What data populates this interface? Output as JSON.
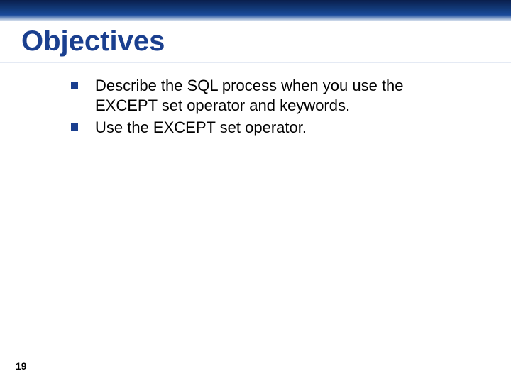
{
  "slide": {
    "title": "Objectives",
    "bullets": [
      {
        "text": "Describe the SQL process when you use the EXCEPT set operator and keywords."
      },
      {
        "text": "Use the EXCEPT set operator."
      }
    ],
    "page_number": "19"
  }
}
